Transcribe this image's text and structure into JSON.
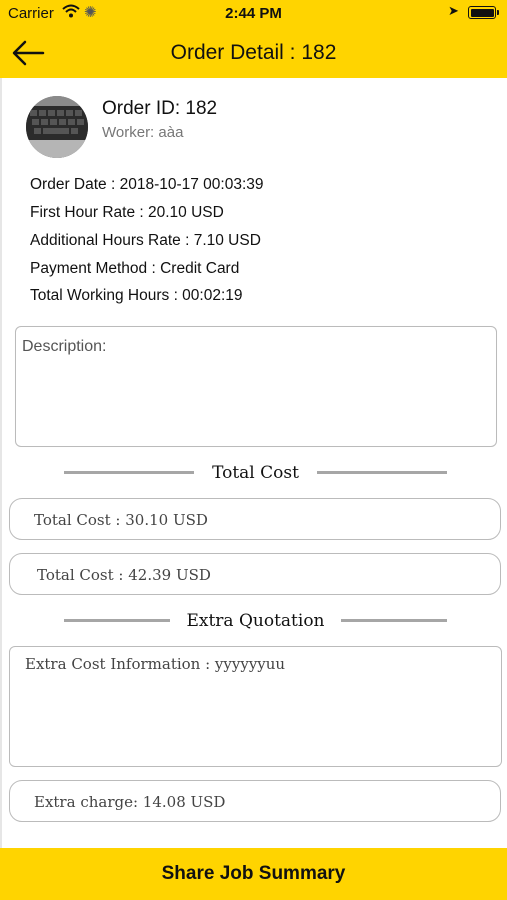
{
  "status_bar": {
    "carrier": "Carrier",
    "time": "2:44 PM"
  },
  "nav": {
    "title": "Order Detail : 182",
    "back_icon": "arrow-left-icon"
  },
  "order": {
    "id_text": "Order ID: 182",
    "worker_text": "Worker: aàa",
    "order_date": "Order Date :  2018-10-17 00:03:39",
    "first_hour_rate": "First Hour Rate : 20.10 USD",
    "additional_hours_rate": "Additional Hours Rate : 7.10 USD",
    "payment_method": "Payment Method  : Credit Card",
    "total_working_hours": "Total Working Hours : 00:02:19"
  },
  "description": {
    "placeholder": "Description:"
  },
  "total_cost_section": {
    "heading": "Total Cost",
    "line1": "Total Cost : 30.10 USD",
    "line2": "Total Cost :   42.39 USD"
  },
  "extra_section": {
    "heading": "Extra Quotation",
    "info": "Extra Cost Information : yyyyyyuu",
    "charge": "Extra charge: 14.08 USD"
  },
  "footer": {
    "share_label": "Share Job Summary"
  },
  "colors": {
    "brand_yellow": "#ffd400",
    "divider_gray": "#a6a6a6"
  }
}
